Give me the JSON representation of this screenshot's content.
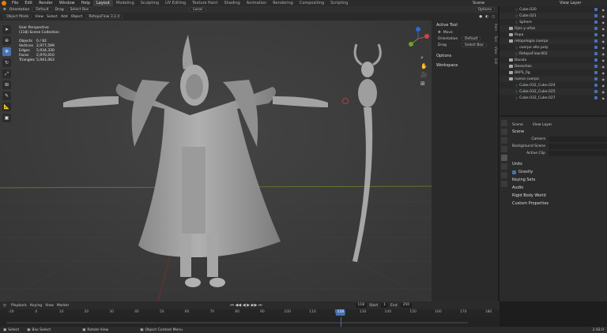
{
  "top_menu": [
    "File",
    "Edit",
    "Render",
    "Window",
    "Help"
  ],
  "workspaces": [
    "Layout",
    "Modeling",
    "Sculpting",
    "UV Editing",
    "Texture Paint",
    "Shading",
    "Animation",
    "Rendering",
    "Compositing",
    "Scripting"
  ],
  "active_workspace": "Layout",
  "scene_name": "Scene",
  "view_layer_name": "View Layer",
  "tool_header": {
    "orientation_label": "Orientation",
    "orientation_value": "Default",
    "drag_label": "Drag",
    "drag_value": "Select Box",
    "transform": "Local",
    "options": "Options"
  },
  "viewport_header": {
    "mode": "Object Mode",
    "menus": [
      "View",
      "Select",
      "Add",
      "Object"
    ],
    "addon": "RetopoFlow 3.2.4"
  },
  "stats": {
    "view_name": "User Perspective",
    "collection": "(118) Scene Collection",
    "rows": [
      {
        "k": "Objects",
        "v": "0 / 82"
      },
      {
        "k": "Vertices",
        "v": "2,977,599"
      },
      {
        "k": "Edges",
        "v": "5,934,330"
      },
      {
        "k": "Faces",
        "v": "2,970,010"
      },
      {
        "k": "Triangles",
        "v": "5,941,063"
      }
    ]
  },
  "npanel": {
    "active_tool": "Active Tool",
    "tool_name": "Move",
    "orientation_label": "Orientation",
    "orientation_value": "Default",
    "drag_label": "Drag",
    "drag_value": "Select Box",
    "options": "Options",
    "workspace": "Workspace",
    "tabs": [
      "Item",
      "Tool",
      "View",
      "Edit"
    ]
  },
  "outliner": [
    {
      "name": "Cube.020",
      "indent": 2
    },
    {
      "name": "Cube.021",
      "indent": 2
    },
    {
      "name": "Sphere",
      "indent": 2
    },
    {
      "name": "Ojos y uñas",
      "indent": 1
    },
    {
      "name": "Ropa",
      "indent": 1
    },
    {
      "name": "retopologia cuerpo",
      "indent": 1
    },
    {
      "name": "cuerpo alto poly",
      "indent": 2
    },
    {
      "name": "RetopoFlow.002",
      "indent": 2
    },
    {
      "name": "Baculo",
      "indent": 1
    },
    {
      "name": "Desechos",
      "indent": 1
    },
    {
      "name": "BKPS_0g",
      "indent": 1
    },
    {
      "name": "nuevo cuerpo",
      "indent": 1
    },
    {
      "name": "Cube.032_Cube.024",
      "indent": 2
    },
    {
      "name": "Cube.032_Cube.025",
      "indent": 2
    },
    {
      "name": "Cube.032_Cube.027",
      "indent": 2
    }
  ],
  "properties": {
    "breadcrumb_scene": "Scene",
    "breadcrumb_layer": "View Layer",
    "section_scene": "Scene",
    "camera_label": "Camera",
    "background_scene_label": "Background Scene",
    "active_clip_label": "Active Clip",
    "sections": [
      "Units",
      "Gravity",
      "Keying Sets",
      "Audio",
      "Rigid Body World",
      "Custom Properties"
    ],
    "gravity_checked": true
  },
  "timeline": {
    "menus": [
      "Playback",
      "Keying",
      "View",
      "Marker"
    ],
    "current_frame": "118",
    "start_label": "Start",
    "start_value": "1",
    "end_label": "End",
    "end_value": "250",
    "ticks": [
      "-20",
      "0",
      "10",
      "20",
      "30",
      "40",
      "50",
      "60",
      "70",
      "80",
      "90",
      "100",
      "110",
      "120",
      "130",
      "140",
      "150",
      "160",
      "170",
      "180"
    ]
  },
  "statusbar": {
    "select": "Select",
    "box_select": "Box Select",
    "rotate_view": "Rotate View",
    "context_menu": "Object Context Menu",
    "version": "2.92.0"
  },
  "colors": {
    "accent": "#4772b3",
    "viewport": "#3a3a3a",
    "model": "#9a9a9a",
    "logo": "#e87d0d"
  }
}
